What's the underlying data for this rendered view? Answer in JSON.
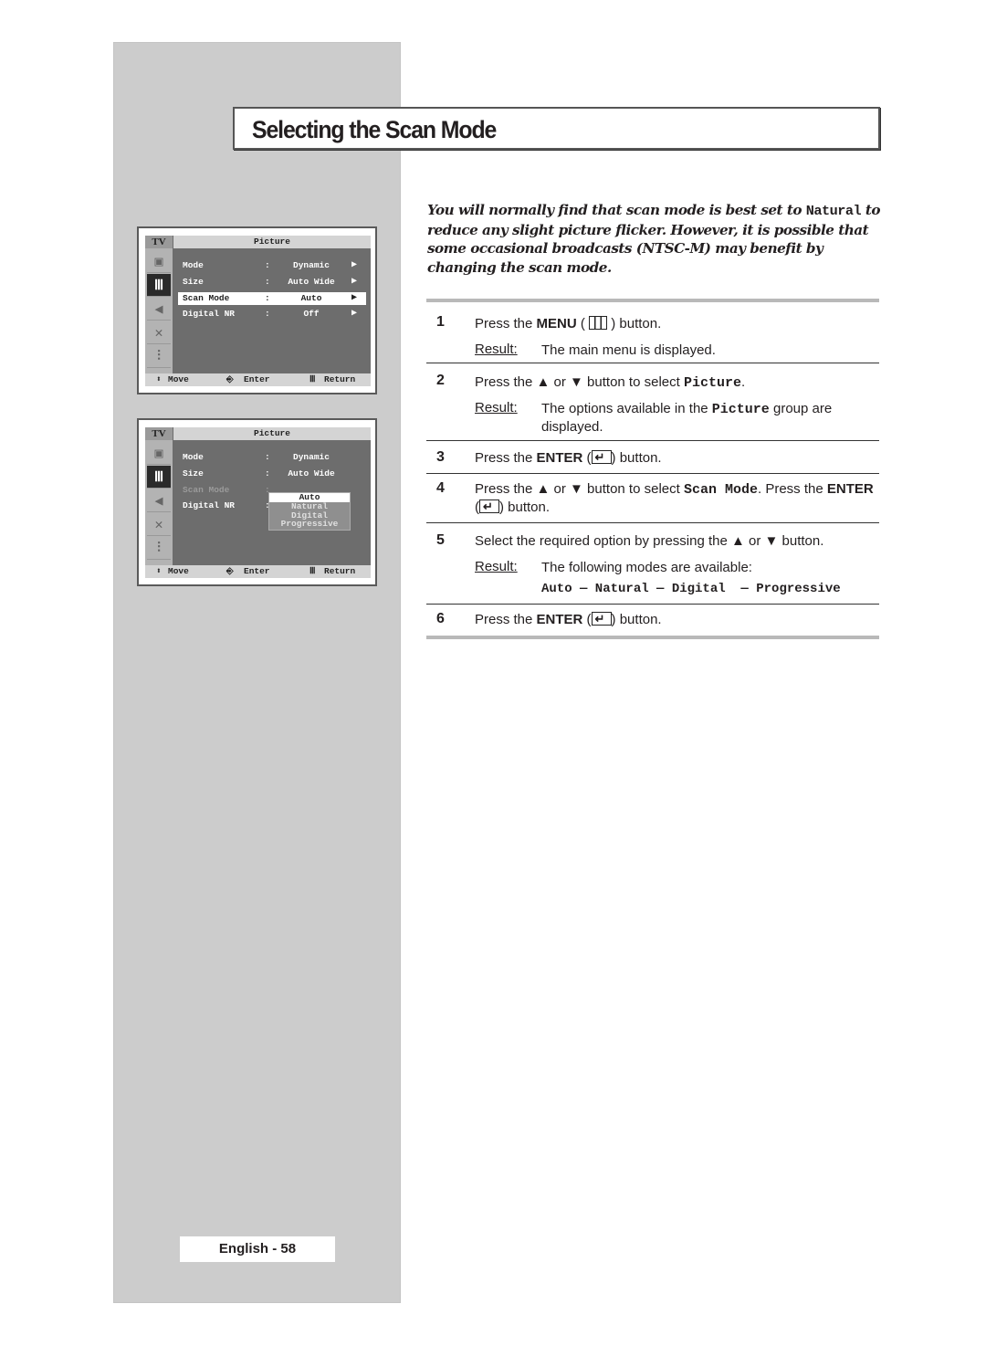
{
  "page": {
    "title": "Selecting the Scan Mode",
    "footer": "English - 58"
  },
  "intro": {
    "before": "You will normally find that scan mode is best set to ",
    "code": "Natural",
    "after": " to reduce any slight picture flicker. However, it is possible that some occasional broadcasts (NTSC-M) may benefit by changing the scan mode."
  },
  "osd_common": {
    "tab": "TV",
    "title": "Picture",
    "sidebar_icons": [
      "setup-icon",
      "picture-icon",
      "sound-icon",
      "channel-antenna-icon",
      "function-sliders-icon"
    ],
    "footer": {
      "move": "Move",
      "enter": "Enter",
      "return": "Return"
    },
    "colon": ":",
    "arrow": "▶"
  },
  "osd1": {
    "rows": [
      {
        "label": "Mode",
        "value": "Dynamic"
      },
      {
        "label": "Size",
        "value": "Auto Wide"
      },
      {
        "label": "Scan Mode",
        "value": "Auto"
      },
      {
        "label": "Digital NR",
        "value": "Off"
      }
    ],
    "selected_row": "Scan Mode"
  },
  "osd2": {
    "rows": [
      {
        "label": "Mode",
        "value": "Dynamic"
      },
      {
        "label": "Size",
        "value": "Auto Wide"
      },
      {
        "label": "Scan Mode",
        "value": ""
      },
      {
        "label": "Digital NR",
        "value": ""
      }
    ],
    "dropdown": [
      "Auto",
      "Natural",
      "Digital",
      "Progressive"
    ],
    "dropdown_selected": "Auto"
  },
  "steps": [
    {
      "num": "1",
      "pre": "Press the ",
      "bold": "MENU",
      "post": " button.",
      "result_label": "Result:",
      "result": "The main menu is displayed."
    },
    {
      "num": "2",
      "pre": "Press the ▲ or ▼ button to select ",
      "code": "Picture",
      "post": ".",
      "result_label": "Result:",
      "result_pre": "The options available in the ",
      "result_code": "Picture",
      "result_post": " group are displayed."
    },
    {
      "num": "3",
      "pre": "Press the ",
      "bold": "ENTER",
      "post": " button."
    },
    {
      "num": "4",
      "pre": "Press the ▲ or ▼ button to select ",
      "code": "Scan Mode",
      "mid": ". Press the ",
      "bold": "ENTER",
      "post": " button."
    },
    {
      "num": "5",
      "pre": "Select the required option by pressing the ▲ or ▼ button.",
      "result_label": "Result:",
      "result": "The following modes are available:",
      "modes": "Auto — Natural — Digital  — Progressive"
    },
    {
      "num": "6",
      "pre": "Press the ",
      "bold": "ENTER",
      "post": " button."
    }
  ]
}
